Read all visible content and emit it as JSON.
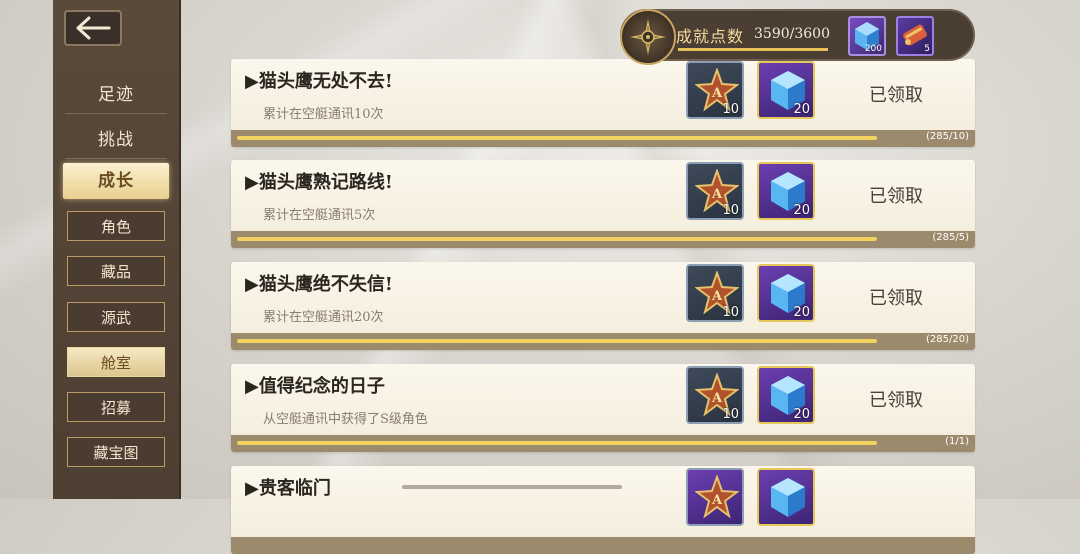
{
  "sidebar": {
    "categories": [
      "足迹",
      "挑战",
      "成长"
    ],
    "subs": [
      "角色",
      "藏品",
      "源武",
      "舱室",
      "招募",
      "藏宝图"
    ]
  },
  "header": {
    "points_label": "成就点数",
    "points_value": "3590/3600",
    "progress_fraction": 0.997,
    "items": [
      {
        "icon": "blue-crystal-icon",
        "qty": "200"
      },
      {
        "icon": "scroll-icon",
        "qty": "5"
      }
    ]
  },
  "rows": [
    {
      "title": "▶猫头鹰无处不去!",
      "desc": "累计在空艇通讯10次",
      "medal_qty": "10",
      "cube_qty": "20",
      "status": "已领取",
      "progress_text": "(285/10)",
      "progress_fraction": 1.0
    },
    {
      "title": "▶猫头鹰熟记路线!",
      "desc": "累计在空艇通讯5次",
      "medal_qty": "10",
      "cube_qty": "20",
      "status": "已领取",
      "progress_text": "(285/5)",
      "progress_fraction": 1.0
    },
    {
      "title": "▶猫头鹰绝不失信!",
      "desc": "累计在空艇通讯20次",
      "medal_qty": "10",
      "cube_qty": "20",
      "status": "已领取",
      "progress_text": "(285/20)",
      "progress_fraction": 1.0
    },
    {
      "title": "▶值得纪念的日子",
      "desc": "从空艇通讯中获得了S级角色",
      "medal_qty": "10",
      "cube_qty": "20",
      "status": "已领取",
      "progress_text": "(1/1)",
      "progress_fraction": 1.0
    },
    {
      "title": "▶贵客临门",
      "desc": "",
      "medal_qty": "",
      "cube_qty": "",
      "status": "",
      "progress_text": "",
      "progress_fraction": 0
    }
  ],
  "colors": {
    "accent_gold": "#f1d160",
    "sidebar_bg": "#5a4a3b",
    "row_bg": "#fbf7ec"
  }
}
